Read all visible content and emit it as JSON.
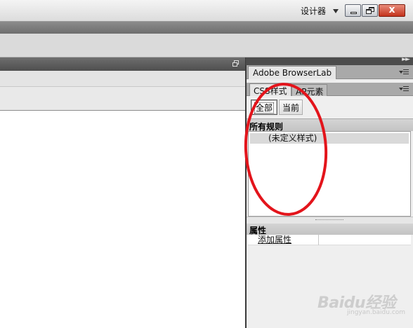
{
  "titlebar": {
    "designer_label": "设计器",
    "close_label": "x"
  },
  "browserlab_panel": {
    "tab_label": "Adobe BrowserLab"
  },
  "css_panel": {
    "tabs": [
      {
        "label": "CSS样式",
        "active": true
      },
      {
        "label": "AP元素",
        "active": false
      }
    ],
    "mode_buttons": {
      "all_label": "全部",
      "current_label": "当前",
      "selected": "全部"
    },
    "rules_header": "所有规则",
    "rules": [
      "(未定义样式)"
    ],
    "properties_header": "属性",
    "add_property_label": "添加属性"
  },
  "watermark": {
    "main": "Baidu经验",
    "sub": "jingyan.baidu.com"
  },
  "colors": {
    "annotation": "#e3141b",
    "dark_chrome": "#4c4c4c",
    "panel_bg": "#efefef"
  }
}
